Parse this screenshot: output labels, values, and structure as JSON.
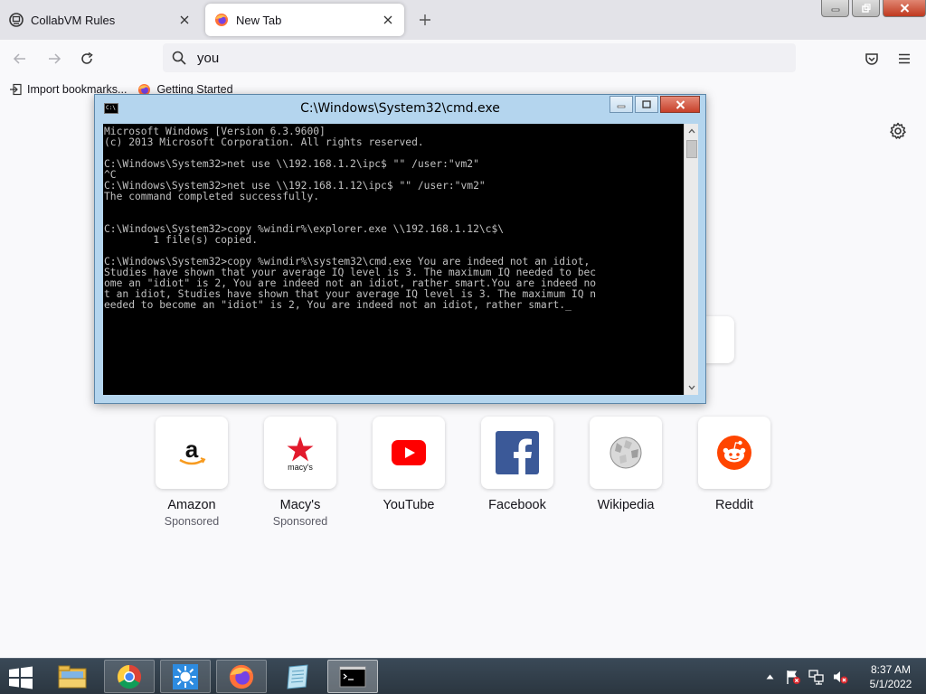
{
  "browser": {
    "tabs": [
      {
        "title": "CollabVM Rules",
        "active": false,
        "icon": "collabvm-icon"
      },
      {
        "title": "New Tab",
        "active": true,
        "icon": "firefox-icon"
      }
    ],
    "url_value": "you",
    "bookmarks": [
      {
        "label": "Import bookmarks...",
        "icon": "import-icon"
      },
      {
        "label": "Getting Started",
        "icon": "firefox-icon"
      }
    ]
  },
  "top_sites": [
    {
      "name": "Amazon",
      "sub": "Sponsored",
      "icon": "amazon-logo"
    },
    {
      "name": "Macy's",
      "sub": "Sponsored",
      "icon": "macys-logo",
      "logo_text": "macy's"
    },
    {
      "name": "YouTube",
      "sub": "",
      "icon": "youtube-logo"
    },
    {
      "name": "Facebook",
      "sub": "",
      "icon": "facebook-logo"
    },
    {
      "name": "Wikipedia",
      "sub": "",
      "icon": "wikipedia-logo"
    },
    {
      "name": "Reddit",
      "sub": "",
      "icon": "reddit-logo"
    }
  ],
  "cmd": {
    "title": "C:\\Windows\\System32\\cmd.exe",
    "icon_text": "C:\\",
    "lines": [
      "Microsoft Windows [Version 6.3.9600]",
      "(c) 2013 Microsoft Corporation. All rights reserved.",
      "",
      "C:\\Windows\\System32>net use \\\\192.168.1.2\\ipc$ \"\" /user:\"vm2\"",
      "^C",
      "C:\\Windows\\System32>net use \\\\192.168.1.12\\ipc$ \"\" /user:\"vm2\"",
      "The command completed successfully.",
      "",
      "",
      "C:\\Windows\\System32>copy %windir%\\explorer.exe \\\\192.168.1.12\\c$\\",
      "        1 file(s) copied.",
      "",
      "C:\\Windows\\System32>copy %windir%\\system32\\cmd.exe You are indeed not an idiot,",
      "Studies have shown that your average IQ level is 3. The maximum IQ needed to bec",
      "ome an \"idiot\" is 2, You are indeed not an idiot, rather smart.You are indeed no",
      "t an idiot, Studies have shown that your average IQ level is 3. The maximum IQ n",
      "eeded to become an \"idiot\" is 2, You are indeed not an idiot, rather smart._"
    ]
  },
  "taskbar": {
    "apps": [
      {
        "name": "file-explorer",
        "icon": "folder-icon",
        "state": "idle"
      },
      {
        "name": "chrome",
        "icon": "chrome-icon",
        "state": "running"
      },
      {
        "name": "sun-app",
        "icon": "sun-icon",
        "state": "running"
      },
      {
        "name": "firefox",
        "icon": "firefox-icon",
        "state": "running"
      },
      {
        "name": "notepad",
        "icon": "notebook-icon",
        "state": "idle"
      },
      {
        "name": "cmd",
        "icon": "cmd-icon",
        "state": "active"
      }
    ],
    "time": "8:37 AM",
    "date": "5/1/2022"
  },
  "colors": {
    "cmd_frame": "#b4d5ee",
    "cmd_text": "#c0c0c0",
    "taskbar": "#2f3b46",
    "tab_bar": "#e3e3e8"
  }
}
